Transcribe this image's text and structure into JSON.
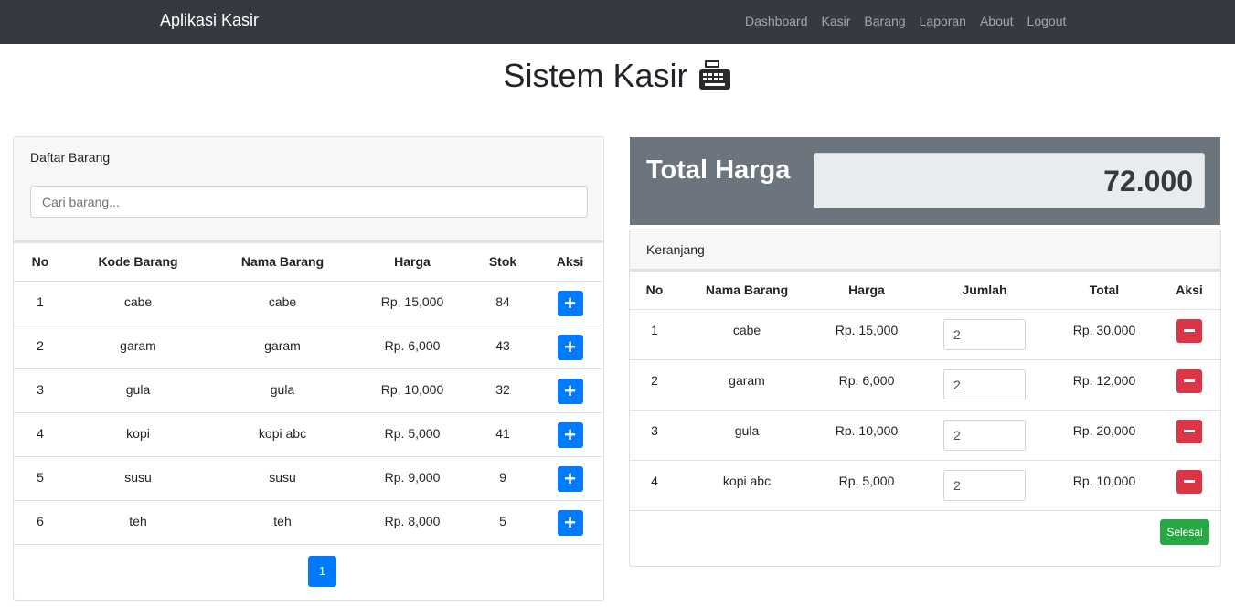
{
  "navbar": {
    "brand": "Aplikasi Kasir",
    "links": [
      "Dashboard",
      "Kasir",
      "Barang",
      "Laporan",
      "About",
      "Logout"
    ]
  },
  "page": {
    "title": "Sistem Kasir"
  },
  "product_list": {
    "header": "Daftar Barang",
    "search_placeholder": "Cari barang...",
    "columns": [
      "No",
      "Kode Barang",
      "Nama Barang",
      "Harga",
      "Stok",
      "Aksi"
    ],
    "rows": [
      {
        "no": "1",
        "kode": "cabe",
        "nama": "cabe",
        "harga": "Rp. 15,000",
        "stok": "84"
      },
      {
        "no": "2",
        "kode": "garam",
        "nama": "garam",
        "harga": "Rp. 6,000",
        "stok": "43"
      },
      {
        "no": "3",
        "kode": "gula",
        "nama": "gula",
        "harga": "Rp. 10,000",
        "stok": "32"
      },
      {
        "no": "4",
        "kode": "kopi",
        "nama": "kopi abc",
        "harga": "Rp. 5,000",
        "stok": "41"
      },
      {
        "no": "5",
        "kode": "susu",
        "nama": "susu",
        "harga": "Rp. 9,000",
        "stok": "9"
      },
      {
        "no": "6",
        "kode": "teh",
        "nama": "teh",
        "harga": "Rp. 8,000",
        "stok": "5"
      }
    ],
    "add_icon": "plus-icon",
    "page_number": "1"
  },
  "total": {
    "label": "Total Harga",
    "value": "72.000"
  },
  "cart": {
    "header": "Keranjang",
    "columns": [
      "No",
      "Nama Barang",
      "Harga",
      "Jumlah",
      "Total",
      "Aksi"
    ],
    "rows": [
      {
        "no": "1",
        "nama": "cabe",
        "harga": "Rp. 15,000",
        "jumlah": "2",
        "total": "Rp. 30,000"
      },
      {
        "no": "2",
        "nama": "garam",
        "harga": "Rp. 6,000",
        "jumlah": "2",
        "total": "Rp. 12,000"
      },
      {
        "no": "3",
        "nama": "gula",
        "harga": "Rp. 10,000",
        "jumlah": "2",
        "total": "Rp. 20,000"
      },
      {
        "no": "4",
        "nama": "kopi abc",
        "harga": "Rp. 5,000",
        "jumlah": "2",
        "total": "Rp. 10,000"
      }
    ],
    "remove_icon": "minus-icon",
    "finish_label": "Selesai"
  },
  "colors": {
    "navbar": "#343a40",
    "primary": "#007bff",
    "danger": "#dc3545",
    "success": "#28a745",
    "total_bg": "#6c757d"
  }
}
